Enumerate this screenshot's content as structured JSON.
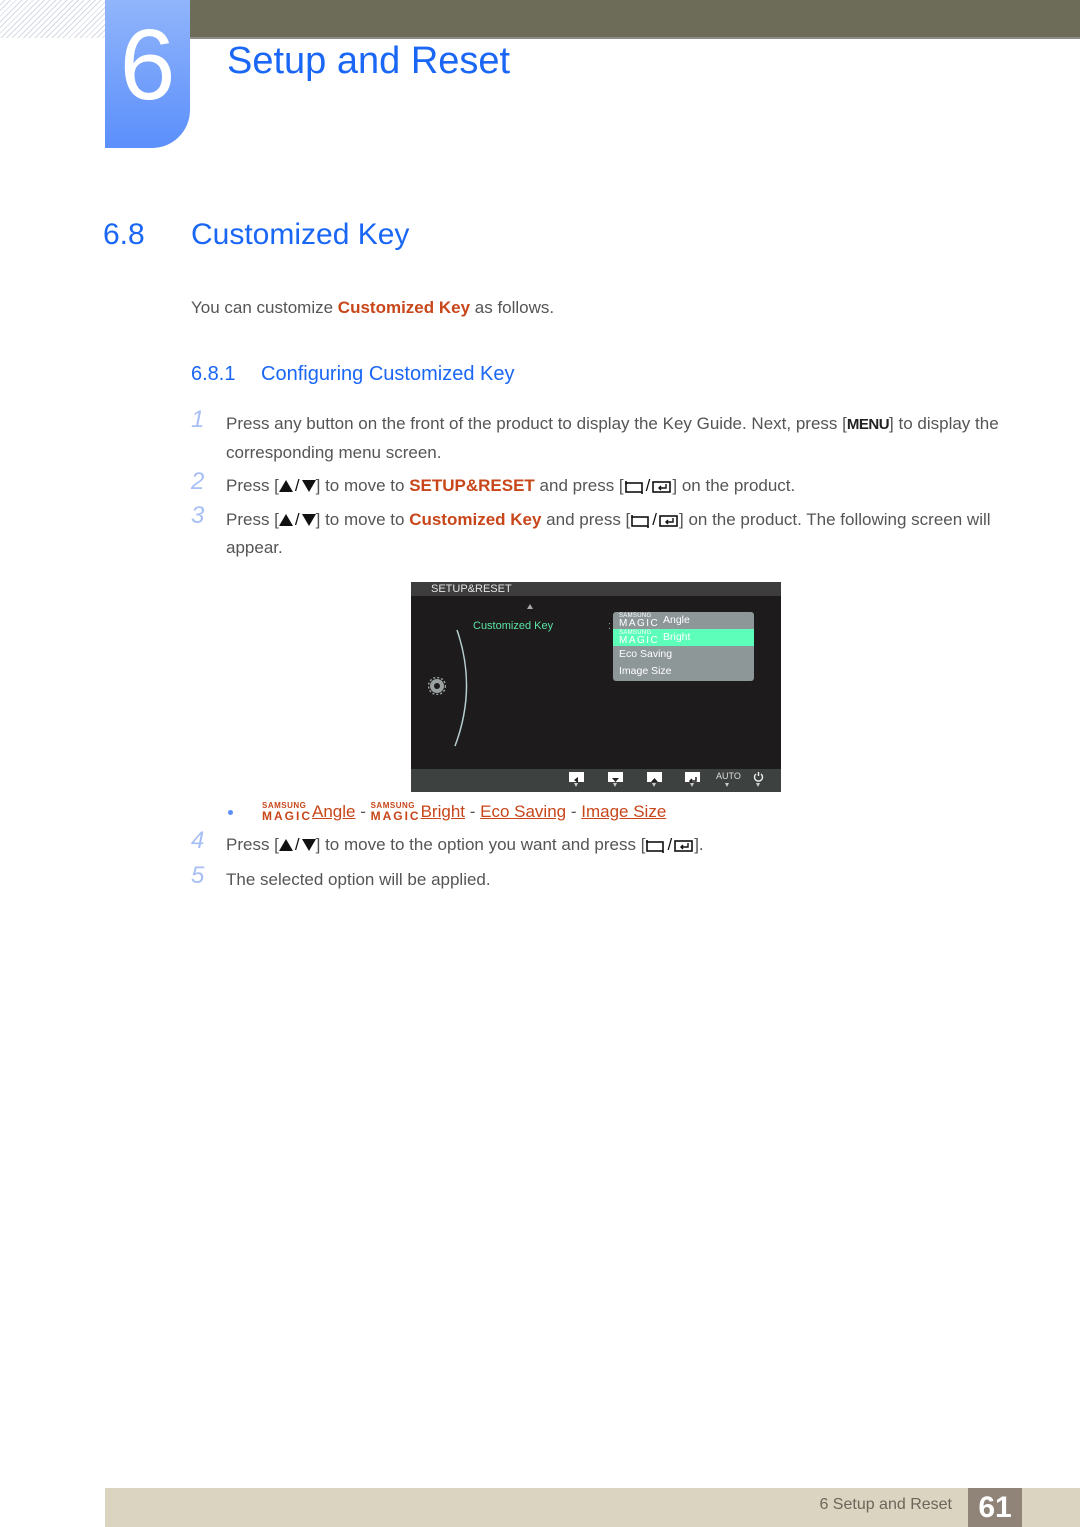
{
  "chapter": {
    "number": "6",
    "title": "Setup and Reset"
  },
  "section": {
    "number": "6.8",
    "title": "Customized Key"
  },
  "intro": {
    "before": "You can customize ",
    "highlight": "Customized Key",
    "after": " as follows."
  },
  "subsection": {
    "number": "6.8.1",
    "title": "Configuring Customized Key"
  },
  "steps": [
    {
      "num": "1",
      "parts": {
        "a": "Press any button on the front of the product to display the Key Guide. Next, press [",
        "key": "MENU",
        "b": "] to display the corresponding menu screen."
      }
    },
    {
      "num": "2",
      "parts": {
        "a": "Press [",
        "b": "] to move to ",
        "highlight": "SETUP&RESET",
        "c": " and press [",
        "d": "] on the product."
      }
    },
    {
      "num": "3",
      "parts": {
        "a": "Press [",
        "b": "] to move to ",
        "highlight": "Customized Key",
        "c": " and press [",
        "d": "] on the product. The following screen will appear."
      }
    },
    {
      "num": "4",
      "parts": {
        "a": "Press [",
        "b": "] to move to the option you want and press [",
        "c": "]."
      }
    },
    {
      "num": "5",
      "parts": {
        "a": "The selected option will be applied."
      }
    }
  ],
  "osd": {
    "header": "SETUP&RESET",
    "menu_label": "Customized Key",
    "colon": ":",
    "options": [
      {
        "brand_top": "SAMSUNG",
        "brand_bottom": "MAGIC",
        "label": "Angle",
        "selected": false
      },
      {
        "brand_top": "SAMSUNG",
        "brand_bottom": "MAGIC",
        "label": "Bright",
        "selected": true
      },
      {
        "label": "Eco Saving",
        "selected": false
      },
      {
        "label": "Image Size",
        "selected": false
      }
    ],
    "footer_buttons": [
      "left-icon",
      "down-icon",
      "up-icon",
      "enter-icon",
      "AUTO",
      "power-icon"
    ],
    "colors": {
      "selected": "#5dfdba",
      "label": "#5ce3a6"
    }
  },
  "options_list": {
    "brand_top": "SAMSUNG",
    "brand_bottom": "MAGIC",
    "items": [
      "Angle",
      "Bright",
      "Eco Saving",
      "Image Size"
    ],
    "separator": " - "
  },
  "footer": {
    "label": "6 Setup and Reset",
    "page": "61"
  },
  "colors": {
    "accent_blue": "#1a66f5",
    "highlight": "#c8461a",
    "topbar": "#6d6c58",
    "footer_bg": "#dad4c0",
    "page_box": "#8f8477"
  }
}
